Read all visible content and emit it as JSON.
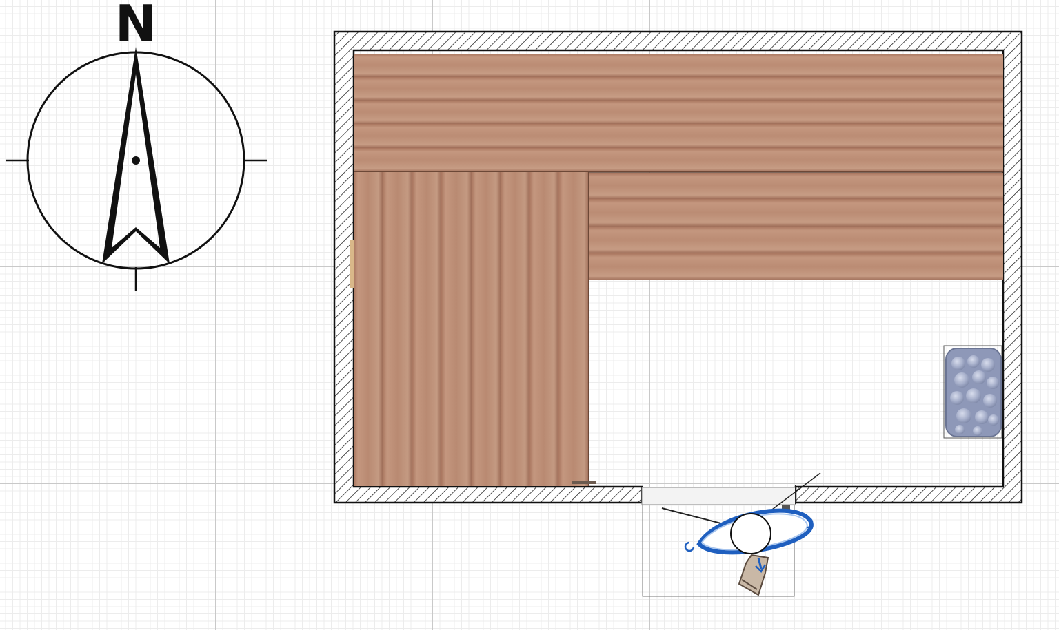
{
  "compass": {
    "north_label": "N"
  },
  "floor_plan": {
    "elements": [
      "wall",
      "upper-bench",
      "lower-bench-left",
      "lower-bench-right",
      "sauna-heater",
      "door",
      "door-handle"
    ]
  },
  "colors": {
    "wall_outline": "#111111",
    "wall_hatch": "#222222",
    "wood_base": "#b98a72",
    "wood_light": "#c49a82",
    "wood_dark": "#a9765f",
    "heater_stones": "#9aa3c2",
    "door_arc": "#1f5fbf",
    "grid_major": "#c9c9c9",
    "grid_minor": "#ececec"
  }
}
